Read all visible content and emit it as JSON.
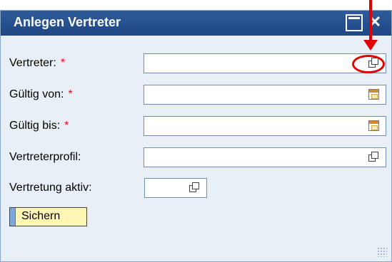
{
  "dialog": {
    "title": "Anlegen Vertreter",
    "required_marker": "*",
    "fields": [
      {
        "label": "Vertreter:",
        "required": true,
        "value": "",
        "button_icon": "copy-icon"
      },
      {
        "label": "Gültig von:",
        "required": true,
        "value": "",
        "button_icon": "calendar-icon"
      },
      {
        "label": "Gültig bis:",
        "required": true,
        "value": "",
        "button_icon": "calendar-icon"
      },
      {
        "label": "Vertreterprofil:",
        "required": false,
        "value": "",
        "button_icon": "copy-icon"
      },
      {
        "label": "Vertretung aktiv:",
        "required": false,
        "value": "",
        "button_icon": "copy-icon"
      }
    ],
    "save_label": "Sichern"
  },
  "colors": {
    "titlebar": "#2e5c9a",
    "annotation": "#e10000",
    "save_button": "#fff6b5"
  }
}
